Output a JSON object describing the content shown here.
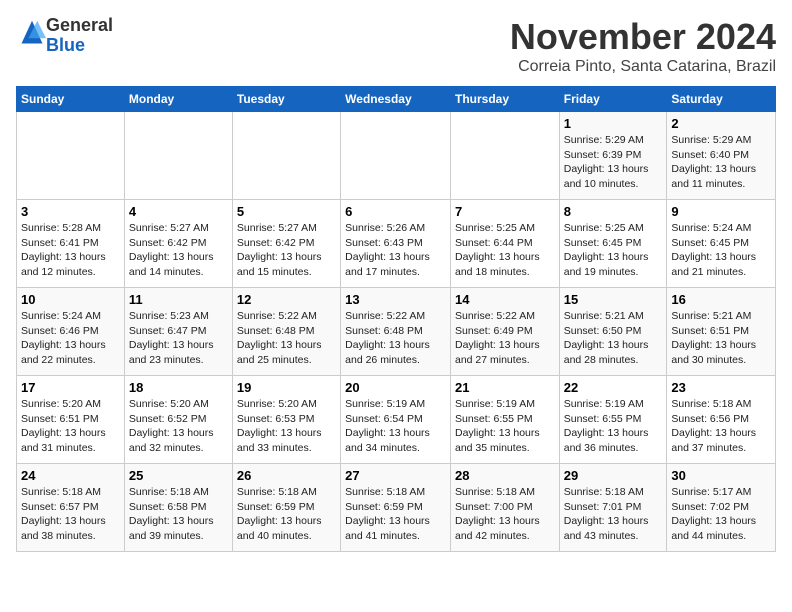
{
  "logo": {
    "general": "General",
    "blue": "Blue"
  },
  "header": {
    "month": "November 2024",
    "location": "Correia Pinto, Santa Catarina, Brazil"
  },
  "weekdays": [
    "Sunday",
    "Monday",
    "Tuesday",
    "Wednesday",
    "Thursday",
    "Friday",
    "Saturday"
  ],
  "weeks": [
    [
      {
        "day": "",
        "info": ""
      },
      {
        "day": "",
        "info": ""
      },
      {
        "day": "",
        "info": ""
      },
      {
        "day": "",
        "info": ""
      },
      {
        "day": "",
        "info": ""
      },
      {
        "day": "1",
        "info": "Sunrise: 5:29 AM\nSunset: 6:39 PM\nDaylight: 13 hours\nand 10 minutes."
      },
      {
        "day": "2",
        "info": "Sunrise: 5:29 AM\nSunset: 6:40 PM\nDaylight: 13 hours\nand 11 minutes."
      }
    ],
    [
      {
        "day": "3",
        "info": "Sunrise: 5:28 AM\nSunset: 6:41 PM\nDaylight: 13 hours\nand 12 minutes."
      },
      {
        "day": "4",
        "info": "Sunrise: 5:27 AM\nSunset: 6:42 PM\nDaylight: 13 hours\nand 14 minutes."
      },
      {
        "day": "5",
        "info": "Sunrise: 5:27 AM\nSunset: 6:42 PM\nDaylight: 13 hours\nand 15 minutes."
      },
      {
        "day": "6",
        "info": "Sunrise: 5:26 AM\nSunset: 6:43 PM\nDaylight: 13 hours\nand 17 minutes."
      },
      {
        "day": "7",
        "info": "Sunrise: 5:25 AM\nSunset: 6:44 PM\nDaylight: 13 hours\nand 18 minutes."
      },
      {
        "day": "8",
        "info": "Sunrise: 5:25 AM\nSunset: 6:45 PM\nDaylight: 13 hours\nand 19 minutes."
      },
      {
        "day": "9",
        "info": "Sunrise: 5:24 AM\nSunset: 6:45 PM\nDaylight: 13 hours\nand 21 minutes."
      }
    ],
    [
      {
        "day": "10",
        "info": "Sunrise: 5:24 AM\nSunset: 6:46 PM\nDaylight: 13 hours\nand 22 minutes."
      },
      {
        "day": "11",
        "info": "Sunrise: 5:23 AM\nSunset: 6:47 PM\nDaylight: 13 hours\nand 23 minutes."
      },
      {
        "day": "12",
        "info": "Sunrise: 5:22 AM\nSunset: 6:48 PM\nDaylight: 13 hours\nand 25 minutes."
      },
      {
        "day": "13",
        "info": "Sunrise: 5:22 AM\nSunset: 6:48 PM\nDaylight: 13 hours\nand 26 minutes."
      },
      {
        "day": "14",
        "info": "Sunrise: 5:22 AM\nSunset: 6:49 PM\nDaylight: 13 hours\nand 27 minutes."
      },
      {
        "day": "15",
        "info": "Sunrise: 5:21 AM\nSunset: 6:50 PM\nDaylight: 13 hours\nand 28 minutes."
      },
      {
        "day": "16",
        "info": "Sunrise: 5:21 AM\nSunset: 6:51 PM\nDaylight: 13 hours\nand 30 minutes."
      }
    ],
    [
      {
        "day": "17",
        "info": "Sunrise: 5:20 AM\nSunset: 6:51 PM\nDaylight: 13 hours\nand 31 minutes."
      },
      {
        "day": "18",
        "info": "Sunrise: 5:20 AM\nSunset: 6:52 PM\nDaylight: 13 hours\nand 32 minutes."
      },
      {
        "day": "19",
        "info": "Sunrise: 5:20 AM\nSunset: 6:53 PM\nDaylight: 13 hours\nand 33 minutes."
      },
      {
        "day": "20",
        "info": "Sunrise: 5:19 AM\nSunset: 6:54 PM\nDaylight: 13 hours\nand 34 minutes."
      },
      {
        "day": "21",
        "info": "Sunrise: 5:19 AM\nSunset: 6:55 PM\nDaylight: 13 hours\nand 35 minutes."
      },
      {
        "day": "22",
        "info": "Sunrise: 5:19 AM\nSunset: 6:55 PM\nDaylight: 13 hours\nand 36 minutes."
      },
      {
        "day": "23",
        "info": "Sunrise: 5:18 AM\nSunset: 6:56 PM\nDaylight: 13 hours\nand 37 minutes."
      }
    ],
    [
      {
        "day": "24",
        "info": "Sunrise: 5:18 AM\nSunset: 6:57 PM\nDaylight: 13 hours\nand 38 minutes."
      },
      {
        "day": "25",
        "info": "Sunrise: 5:18 AM\nSunset: 6:58 PM\nDaylight: 13 hours\nand 39 minutes."
      },
      {
        "day": "26",
        "info": "Sunrise: 5:18 AM\nSunset: 6:59 PM\nDaylight: 13 hours\nand 40 minutes."
      },
      {
        "day": "27",
        "info": "Sunrise: 5:18 AM\nSunset: 6:59 PM\nDaylight: 13 hours\nand 41 minutes."
      },
      {
        "day": "28",
        "info": "Sunrise: 5:18 AM\nSunset: 7:00 PM\nDaylight: 13 hours\nand 42 minutes."
      },
      {
        "day": "29",
        "info": "Sunrise: 5:18 AM\nSunset: 7:01 PM\nDaylight: 13 hours\nand 43 minutes."
      },
      {
        "day": "30",
        "info": "Sunrise: 5:17 AM\nSunset: 7:02 PM\nDaylight: 13 hours\nand 44 minutes."
      }
    ]
  ]
}
